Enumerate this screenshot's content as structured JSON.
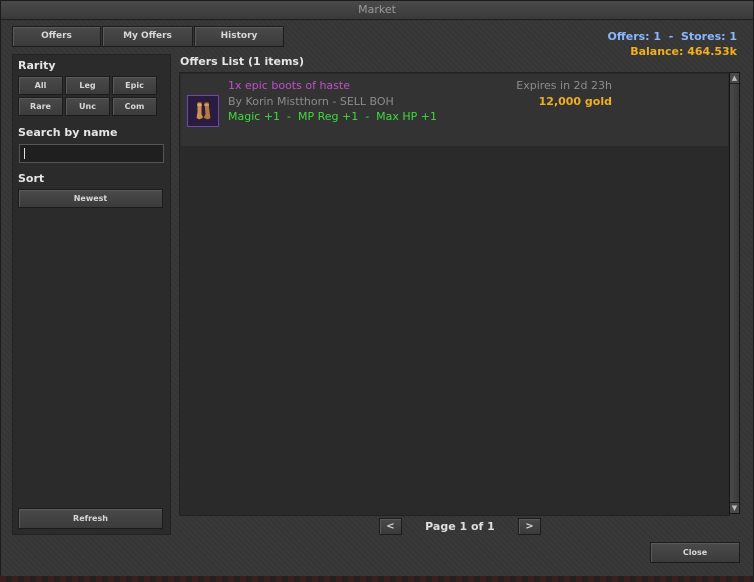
{
  "window": {
    "title": "Market"
  },
  "tabs": [
    {
      "label": "Offers"
    },
    {
      "label": "My Offers"
    },
    {
      "label": "History"
    }
  ],
  "stats": {
    "offers_stores": "Offers: 1  -  Stores: 1",
    "balance": "Balance: 464.53k"
  },
  "filters": {
    "rarity_label": "Rarity",
    "rarity_buttons": [
      {
        "label": "All"
      },
      {
        "label": "Leg"
      },
      {
        "label": "Epic"
      },
      {
        "label": "Rare"
      },
      {
        "label": "Unc"
      },
      {
        "label": "Com"
      }
    ],
    "search_label": "Search by name",
    "search_value": "",
    "sort_label": "Sort",
    "sort_value": "Newest",
    "refresh_label": "Refresh"
  },
  "list": {
    "title": "Offers List (1 items)",
    "items": [
      {
        "name": "1x epic boots of haste",
        "seller": "By Korin Mistthorn - SELL BOH",
        "attributes": "Magic +1  -  MP Reg +1  -  Max HP +1",
        "expires": "Expires in 2d 23h",
        "price": "12,000 gold",
        "icon": "boots-icon"
      }
    ]
  },
  "pagination": {
    "prev_label": "<",
    "next_label": ">",
    "page_text": "Page 1 of 1"
  },
  "close_label": "Close",
  "colors": {
    "epic": "#c050c8",
    "attribute": "#3ddc3d",
    "price": "#f0b020",
    "stats": "#8ab8ff"
  }
}
